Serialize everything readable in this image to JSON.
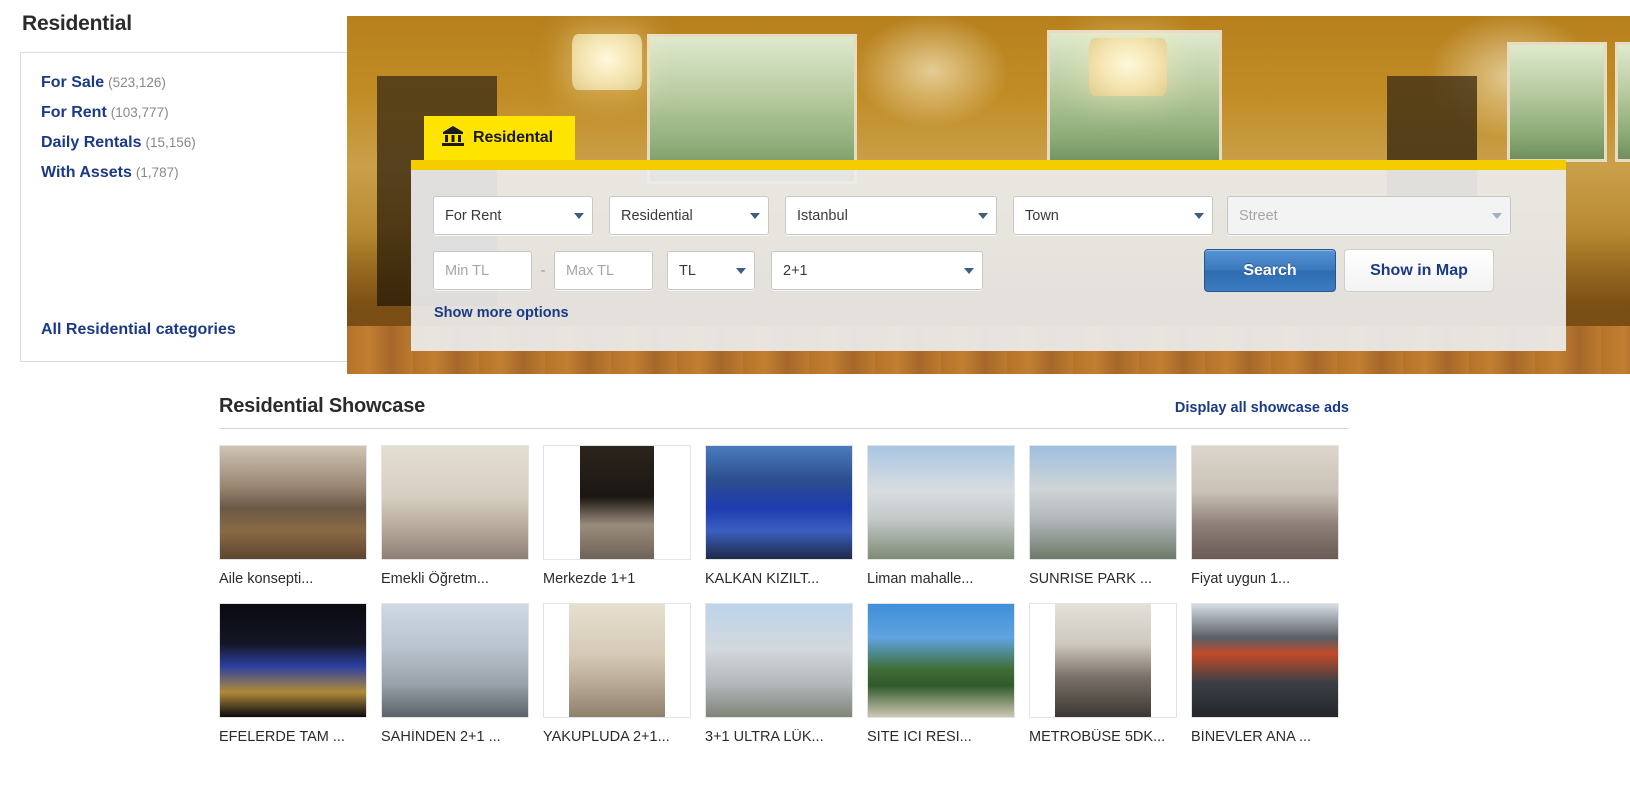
{
  "sidebar": {
    "title": "Residential",
    "categories": [
      {
        "label": "For Sale",
        "count": "(523,126)"
      },
      {
        "label": "For Rent",
        "count": "(103,777)"
      },
      {
        "label": "Daily Rentals",
        "count": "(15,156)"
      },
      {
        "label": "With Assets",
        "count": "(1,787)"
      }
    ],
    "all_categories_label": "All Residential categories"
  },
  "hero": {
    "tab_label": "Residental",
    "tab_icon": "house-bank-icon",
    "tab_bg": "#ffe400"
  },
  "search": {
    "listing_type": "For Rent",
    "property_type": "Residential",
    "city": "İstanbul",
    "town": "Town",
    "street_placeholder": "Street",
    "street_value": "",
    "min_price_placeholder": "Min TL",
    "min_price_value": "",
    "max_price_placeholder": "Max TL",
    "max_price_value": "",
    "range_separator": "-",
    "currency": "TL",
    "rooms": "2+1",
    "search_label": "Search",
    "map_label": "Show in Map",
    "more_options_label": "Show more options",
    "accent_blue": "#3a79bd",
    "link_blue": "#1a3a87"
  },
  "showcase": {
    "title": "Residential Showcase",
    "all_link_label": "Display all showcase ads",
    "rows": [
      [
        {
          "caption": "Aile konsepti...",
          "thumb": "interior-living-room"
        },
        {
          "caption": "Emekli Öğretm...",
          "thumb": "interior-lounge"
        },
        {
          "caption": "Merkezde 1+1",
          "thumb": "interior-hallway-door"
        },
        {
          "caption": "KALKAN KIZILT...",
          "thumb": "villa-pool-night"
        },
        {
          "caption": "Liman mahalle...",
          "thumb": "apartment-block-exterior"
        },
        {
          "caption": "SUNRISE PARK ...",
          "thumb": "modern-apartment-complex"
        },
        {
          "caption": "Fiyat uygun 1...",
          "thumb": "interior-bedroom"
        }
      ],
      [
        {
          "caption": "EFELERDE TAM ...",
          "thumb": "villa-illuminated-night"
        },
        {
          "caption": "SAHİNDEN 2+1 ...",
          "thumb": "street-apartment-buildings"
        },
        {
          "caption": "YAKUPLUDA 2+1...",
          "thumb": "empty-room-windows"
        },
        {
          "caption": "3+1 ULTRA LÜK...",
          "thumb": "white-apartment-facade"
        },
        {
          "caption": "SITE ICI RESI...",
          "thumb": "palm-trees-site"
        },
        {
          "caption": "METROBÜSE 5DK...",
          "thumb": "interior-entrance-corridor"
        },
        {
          "caption": "BİNEVLER ANA ...",
          "thumb": "building-with-sign"
        }
      ]
    ]
  }
}
